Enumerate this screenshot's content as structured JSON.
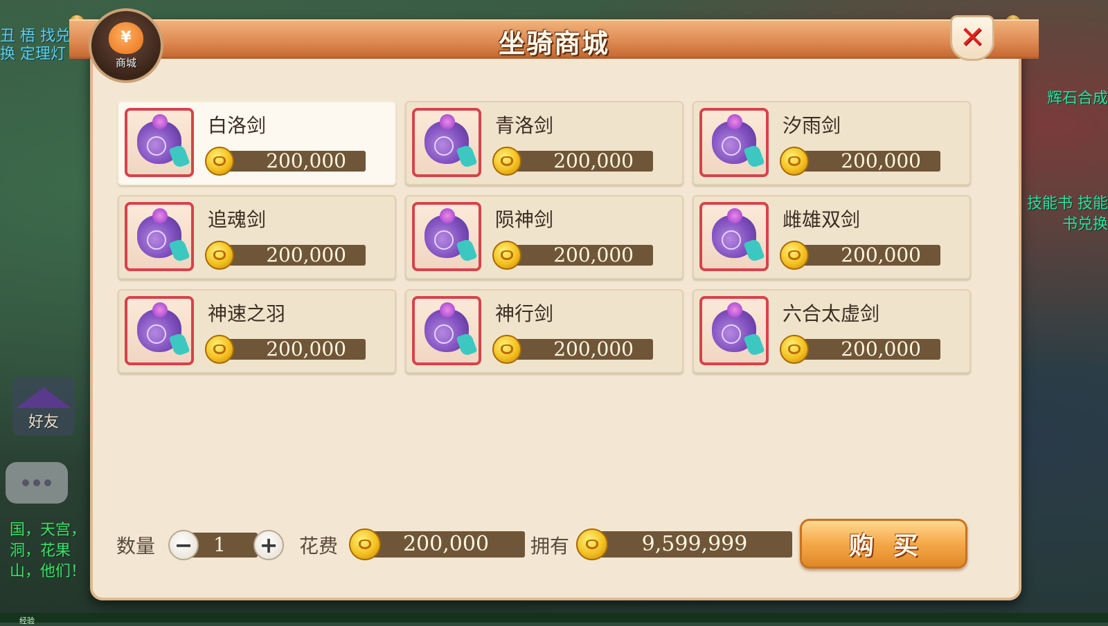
{
  "background": {
    "left_top_text": "丑 梧 找兑换 定理灯",
    "left_bottom_text": "国，天宫，洞，花果山，他们！",
    "right_text_1": "辉石合成",
    "right_text_2": "技能书 技能书兑换",
    "friend_label": "好友",
    "bottom_strip_label": "经验"
  },
  "dialog": {
    "title": "坐骑商城",
    "emblem_label": "商城",
    "emblem_symbol": "¥",
    "close_symbol": "✕"
  },
  "items": [
    {
      "name": "白洛剑",
      "price": "200,000",
      "selected": true
    },
    {
      "name": "青洛剑",
      "price": "200,000"
    },
    {
      "name": "汐雨剑",
      "price": "200,000"
    },
    {
      "name": "追魂剑",
      "price": "200,000"
    },
    {
      "name": "陨神剑",
      "price": "200,000"
    },
    {
      "name": "雌雄双剑",
      "price": "200,000"
    },
    {
      "name": "神速之羽",
      "price": "200,000"
    },
    {
      "name": "神行剑",
      "price": "200,000"
    },
    {
      "name": "六合太虚剑",
      "price": "200,000"
    }
  ],
  "footer": {
    "quantity_label": "数量",
    "quantity_value": "1",
    "minus_symbol": "−",
    "plus_symbol": "+",
    "cost_label": "花费",
    "cost_value": "200,000",
    "owned_label": "拥有",
    "owned_value": "9,599,999",
    "buy_label": "购买"
  },
  "colors": {
    "title_bar": "#e08c55",
    "dialog_bg": "#f3e7d3",
    "price_bar": "#6f5638",
    "icon_border": "#d8424a",
    "buy_button": "#f5a848",
    "close_x": "#e0221e"
  },
  "icons": {
    "item_icon": "purple-pouch-icon",
    "currency_icon": "gold-coin-icon",
    "close_icon": "close-icon",
    "shop_icon": "shop-bag-icon"
  }
}
